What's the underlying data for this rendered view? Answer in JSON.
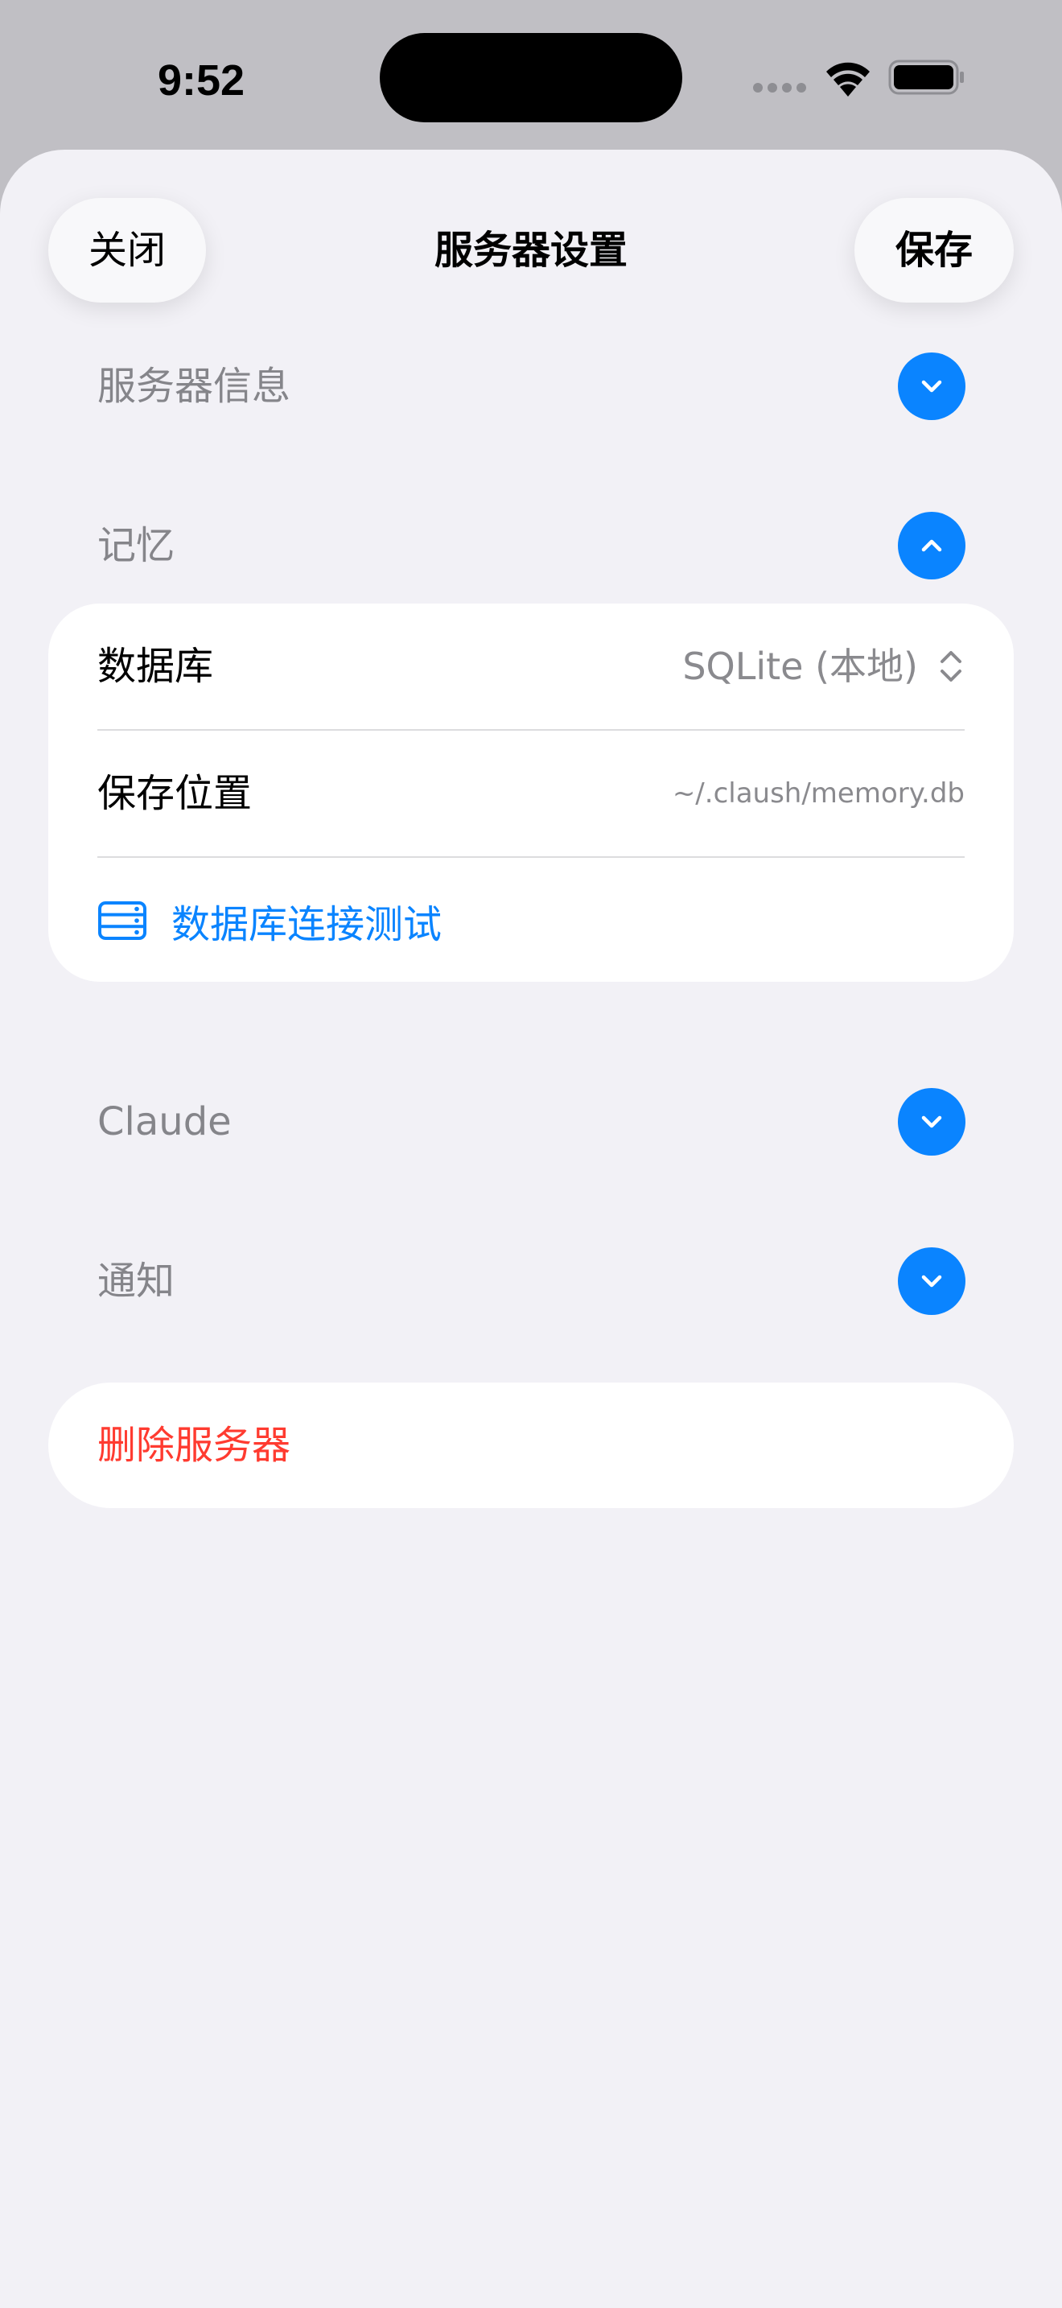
{
  "status_bar": {
    "time": "9:52"
  },
  "nav": {
    "close_label": "关闭",
    "title": "服务器设置",
    "save_label": "保存"
  },
  "sections": {
    "server_info": {
      "label": "服务器信息",
      "expanded": false
    },
    "memory": {
      "label": "记忆",
      "expanded": true,
      "database_label": "数据库",
      "database_value": "SQLite (本地)",
      "location_label": "保存位置",
      "location_value": "~/.claush/memory.db",
      "test_label": "数据库连接测试"
    },
    "claude": {
      "label": "Claude",
      "expanded": false
    },
    "notifications": {
      "label": "通知",
      "expanded": false
    }
  },
  "delete": {
    "label": "删除服务器"
  },
  "colors": {
    "accent": "#0a84ff",
    "destructive": "#ff3b30",
    "background": "#f2f1f6",
    "secondary_text": "#85858a"
  },
  "icons": {
    "collapsed": "chevron-down-icon",
    "expanded": "chevron-up-icon",
    "database": "server-rack-icon",
    "picker": "up-down-chevron-icon"
  }
}
